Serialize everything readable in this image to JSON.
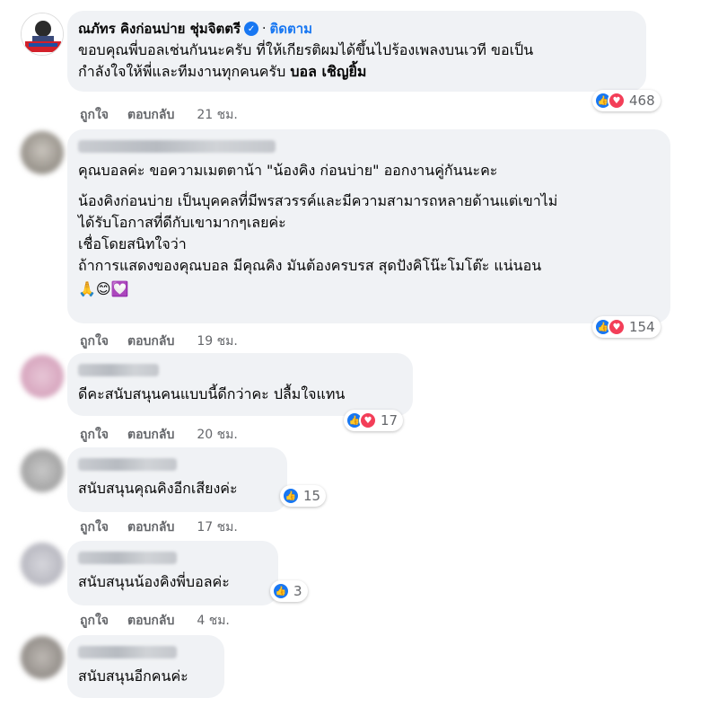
{
  "reply_label": "ตอบกลับ",
  "like_label": "ถูกใจ",
  "comments": [
    {
      "author": "ณภัทร คิงก่อนบ่าย ชุ่มจิตตรี",
      "verified_icon": "verified-badge-icon",
      "follow_label": "ติดตาม",
      "text_line1": "ขอบคุณพี่บอลเช่นกันนะครับ ที่ให้เกียรติผมได้ขึ้นไปร้องเพลงบนเวที ขอเป็น",
      "text_line2": "กำลังใจให้พี่และทีมงานทุกคนครับ",
      "text_bold": "บอล เชิญยิ้ม",
      "reactions": "468",
      "time": "21 ชม."
    },
    {
      "p1": "คุณบอลค่ะ ขอความเมตตาน้า \"น้องคิง ก่อนบ่าย\" ออกงานคู่กันนะคะ",
      "p2": "น้องคิงก่อนบ่าย เป็นบุคคลที่มีพรสวรรค์และมีความสามารถหลายด้านแต่เขาไม่\nได้รับโอกาสที่ดีกับเขามากๆเลยค่ะ\nเชื่อโดยสนิทใจว่า\nถ้าการแสดงของคุณบอล มีคุณคิง มันต้องครบรส สุดปังคิโน๊ะโมโต๊ะ แน่นอน",
      "emojis": "🙏😊💟",
      "reactions": "154",
      "time": "19 ชม."
    },
    {
      "text": "ดีคะสนับสนุนคนแบบนี้ดีกว่าคะ ปลื้มใจแทน",
      "reactions": "17",
      "time": "20 ชม."
    },
    {
      "text": "สนับสนุนคุณคิงอีกเสียงค่ะ",
      "reactions": "15",
      "time": "17 ชม."
    },
    {
      "text": "สนับสนุนน้องคิงพี่บอลค่ะ",
      "reactions": "3",
      "time": "4 ชม."
    },
    {
      "text": "สนับสนุนอีกคนค่ะ"
    }
  ],
  "colors": {
    "bubble": "#f0f2f5",
    "link": "#1877f2",
    "meta": "#65676b",
    "like": "#1877f2",
    "love": "#f33e58"
  }
}
